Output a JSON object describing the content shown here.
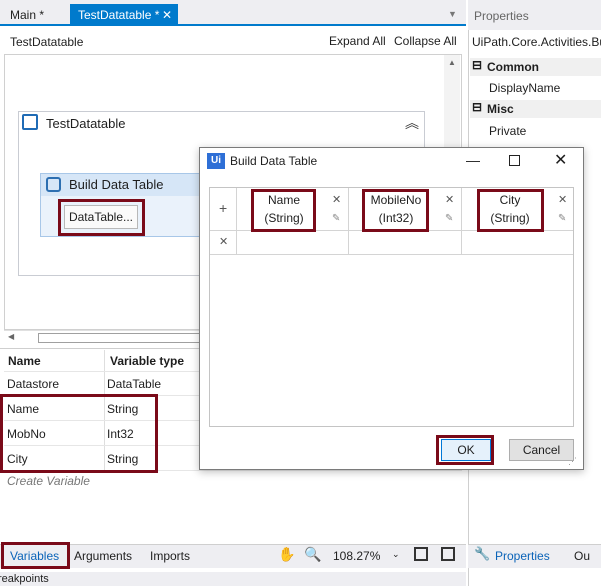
{
  "tabs": [
    {
      "label": "Main *"
    },
    {
      "label": "TestDatatable *"
    }
  ],
  "designer": {
    "title": "TestDatatable",
    "expand_all": "Expand All",
    "collapse_all": "Collapse All"
  },
  "canvas": {
    "sequence_title": "TestDatatable",
    "activity_title": "Build Data Table",
    "datatable_button": "DataTable..."
  },
  "variables": {
    "header_name": "Name",
    "header_type": "Variable type",
    "rows": [
      {
        "name": "Datastore",
        "type": "DataTable"
      },
      {
        "name": "Name",
        "type": "String"
      },
      {
        "name": "MobNo",
        "type": "Int32"
      },
      {
        "name": "City",
        "type": "String"
      }
    ],
    "create_placeholder": "Create Variable"
  },
  "bottom_bar": {
    "tabs": [
      "Variables",
      "Arguments",
      "Imports"
    ],
    "zoom": "108.27%"
  },
  "status": "reakpoints",
  "properties": {
    "title": "Properties",
    "class_name": "UiPath.Core.Activities.Bu",
    "categories": [
      {
        "label": "Common",
        "items": [
          "DisplayName"
        ]
      },
      {
        "label": "Misc",
        "items": [
          "Private"
        ]
      }
    ],
    "bottom_tabs": [
      "Properties",
      "Ou"
    ]
  },
  "dialog": {
    "logo": "Ui",
    "title": "Build Data Table",
    "columns": [
      {
        "name": "Name",
        "type": "(String)"
      },
      {
        "name": "MobileNo",
        "type": "(Int32)"
      },
      {
        "name": "City",
        "type": "(String)"
      }
    ],
    "ok": "OK",
    "cancel": "Cancel"
  },
  "colors": {
    "accent": "#007acc",
    "highlight": "#7a0a19",
    "link": "#0a63b8"
  }
}
